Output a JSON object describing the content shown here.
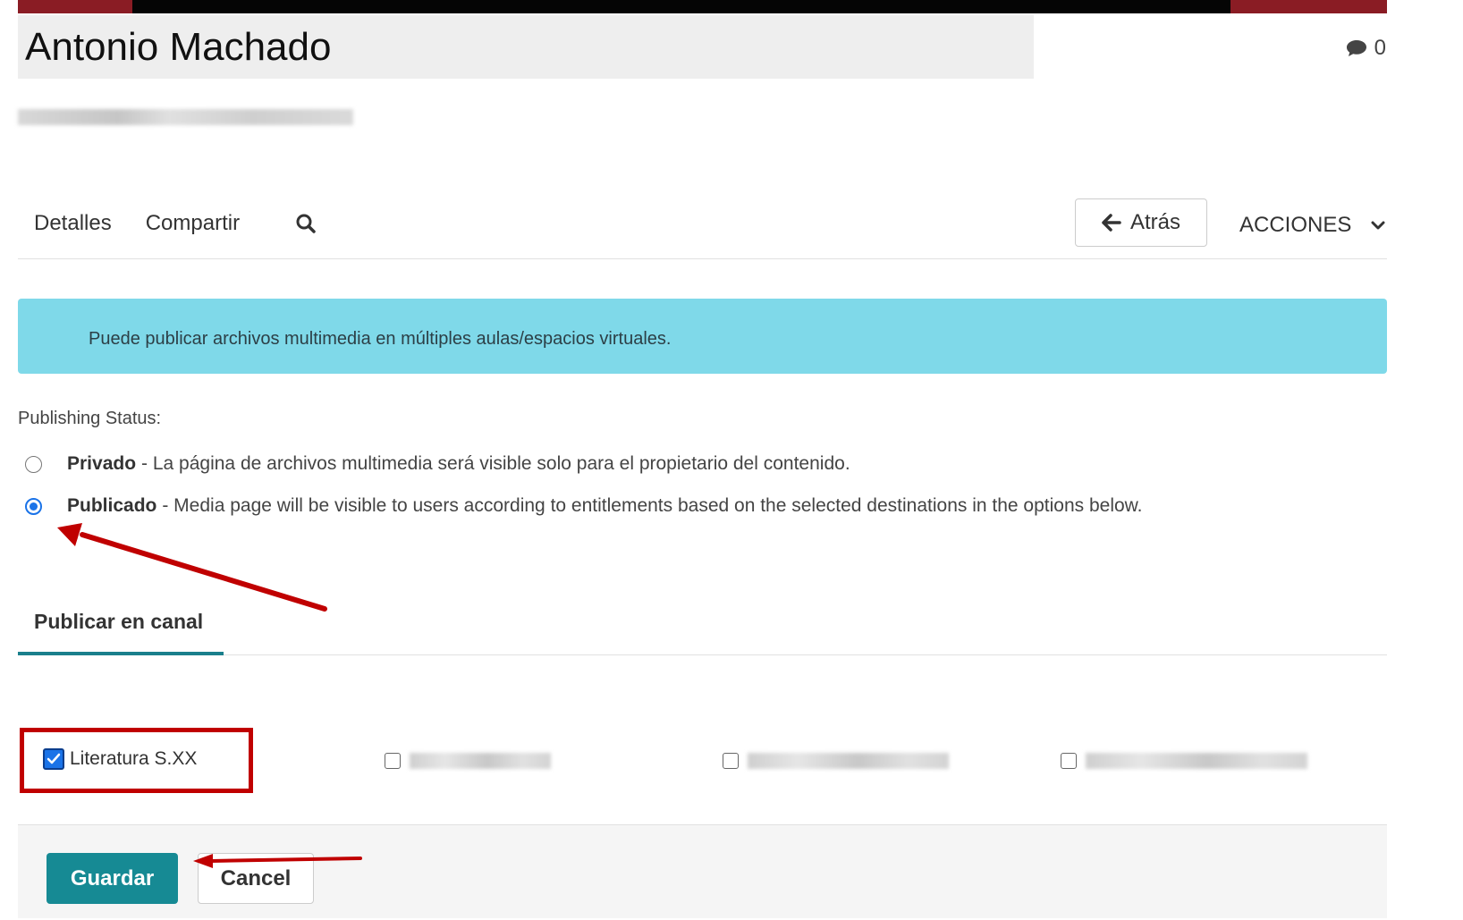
{
  "header": {
    "title": "Antonio Machado",
    "comment_count": "0"
  },
  "nav": {
    "tabs": [
      "Detalles",
      "Compartir"
    ],
    "back_label": "Atrás",
    "actions_label": "ACCIONES"
  },
  "alert": {
    "text": "Puede publicar archivos multimedia en múltiples aulas/espacios virtuales."
  },
  "publishing": {
    "label": "Publishing Status:",
    "options": [
      {
        "title": "Privado",
        "desc": "- La página de archivos multimedia será visible solo para el propietario del contenido.",
        "selected": false
      },
      {
        "title": "Publicado",
        "desc": "- Media page will be visible to users according to entitlements based on the selected destinations in the options below.",
        "selected": true
      }
    ]
  },
  "channel": {
    "tab_label": "Publicar en canal",
    "items": [
      {
        "label": "Literatura S.XX",
        "checked": true
      }
    ]
  },
  "footer": {
    "save_label": "Guardar",
    "cancel_label": "Cancel"
  },
  "colors": {
    "accent": "#168a94",
    "alert_bg": "#7fd9e9",
    "annotation": "#c00000",
    "radio": "#1a73e8"
  }
}
